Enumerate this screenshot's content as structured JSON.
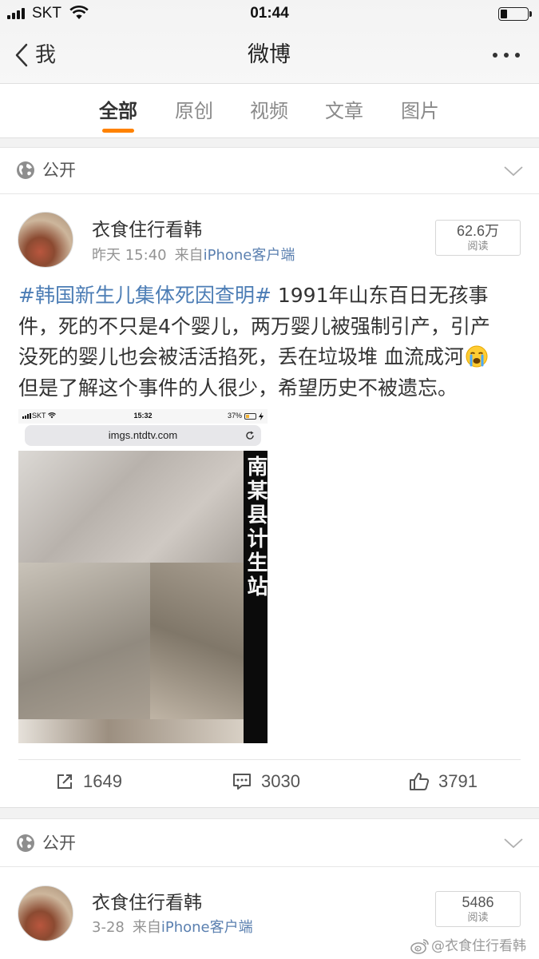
{
  "status_bar": {
    "carrier": "SKT",
    "time": "01:44",
    "battery_level": 0.25
  },
  "nav": {
    "back_label": "我",
    "title": "微博"
  },
  "tabs": [
    {
      "label": "全部",
      "active": true
    },
    {
      "label": "原创",
      "active": false
    },
    {
      "label": "视频",
      "active": false
    },
    {
      "label": "文章",
      "active": false
    },
    {
      "label": "图片",
      "active": false
    }
  ],
  "colors": {
    "accent": "#ff8200",
    "link": "#4c7db5",
    "source": "#5b80b0"
  },
  "posts": [
    {
      "visibility": "公开",
      "author": "衣食住行看韩",
      "time": "昨天 15:40",
      "source_prefix": "来自",
      "source": "iPhone客户端",
      "reads": "62.6万",
      "reads_label": "阅读",
      "body_lines": [
        {
          "topic": "#韩国新生儿集体死因查明#",
          "text": " 1991年山东百日无孩事"
        },
        {
          "text": "件，死的不只是4个婴儿，两万婴儿被强制引产，引产"
        },
        {
          "text": "没死的婴儿也会被活活掐死，丢在垃圾堆 血流成河"
        },
        {
          "text": "但是了解这个事件的人很少，希望历史不被遗忘。"
        }
      ],
      "emoji_icon": "loudly-crying-face-icon",
      "image": {
        "status_carrier": "SKT",
        "status_time": "15:32",
        "status_battery": "37%",
        "url": "imgs.ntdtv.com",
        "overlay_text": "南某县计生站"
      },
      "actions": {
        "reposts": "1649",
        "comments": "3030",
        "likes": "3791"
      }
    },
    {
      "visibility": "公开",
      "author": "衣食住行看韩",
      "time": "3-28",
      "source_prefix": "来自",
      "source": "iPhone客户端",
      "reads": "5486",
      "reads_label": "阅读"
    }
  ],
  "watermark": "@衣食住行看韩"
}
